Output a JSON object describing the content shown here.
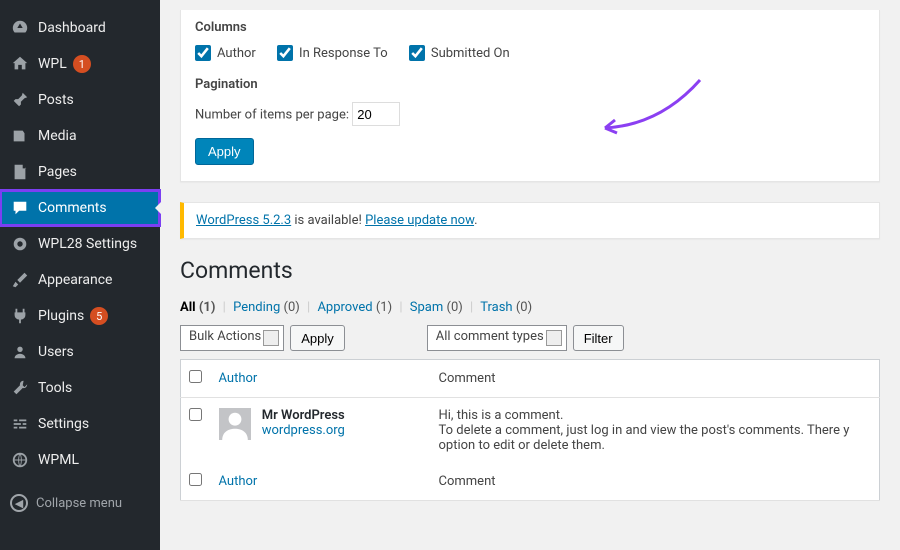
{
  "sidebar": {
    "items": [
      {
        "label": "Dashboard"
      },
      {
        "label": "WPL",
        "badge": "1"
      },
      {
        "label": "Posts"
      },
      {
        "label": "Media"
      },
      {
        "label": "Pages"
      },
      {
        "label": "Comments"
      },
      {
        "label": "WPL28 Settings"
      },
      {
        "label": "Appearance"
      },
      {
        "label": "Plugins",
        "badge": "5"
      },
      {
        "label": "Users"
      },
      {
        "label": "Tools"
      },
      {
        "label": "Settings"
      },
      {
        "label": "WPML"
      }
    ],
    "collapse": "Collapse menu"
  },
  "screen_options": {
    "columns_heading": "Columns",
    "author": "Author",
    "response": "In Response To",
    "submitted": "Submitted On",
    "pagination_heading": "Pagination",
    "per_page_label": "Number of items per page:",
    "per_page_value": "20",
    "apply": "Apply"
  },
  "notice": {
    "link1": "WordPress 5.2.3",
    "mid": " is available! ",
    "link2": "Please update now",
    "end": "."
  },
  "page_title": "Comments",
  "filters": {
    "all": "All",
    "all_cnt": "(1)",
    "pending": "Pending",
    "pending_cnt": "(0)",
    "approved": "Approved",
    "approved_cnt": "(1)",
    "spam": "Spam",
    "spam_cnt": "(0)",
    "trash": "Trash",
    "trash_cnt": "(0)"
  },
  "tablenav": {
    "bulk": "Bulk Actions",
    "apply": "Apply",
    "types": "All comment types",
    "filter": "Filter"
  },
  "table": {
    "col_author": "Author",
    "col_comment": "Comment",
    "rows": [
      {
        "name": "Mr WordPress",
        "site": "wordpress.org",
        "text1": "Hi, this is a comment.",
        "text2": "To delete a comment, just log in and view the post's comments. There y",
        "text3": "option to edit or delete them."
      }
    ],
    "footer_author": "Author",
    "footer_comment": "Comment"
  }
}
